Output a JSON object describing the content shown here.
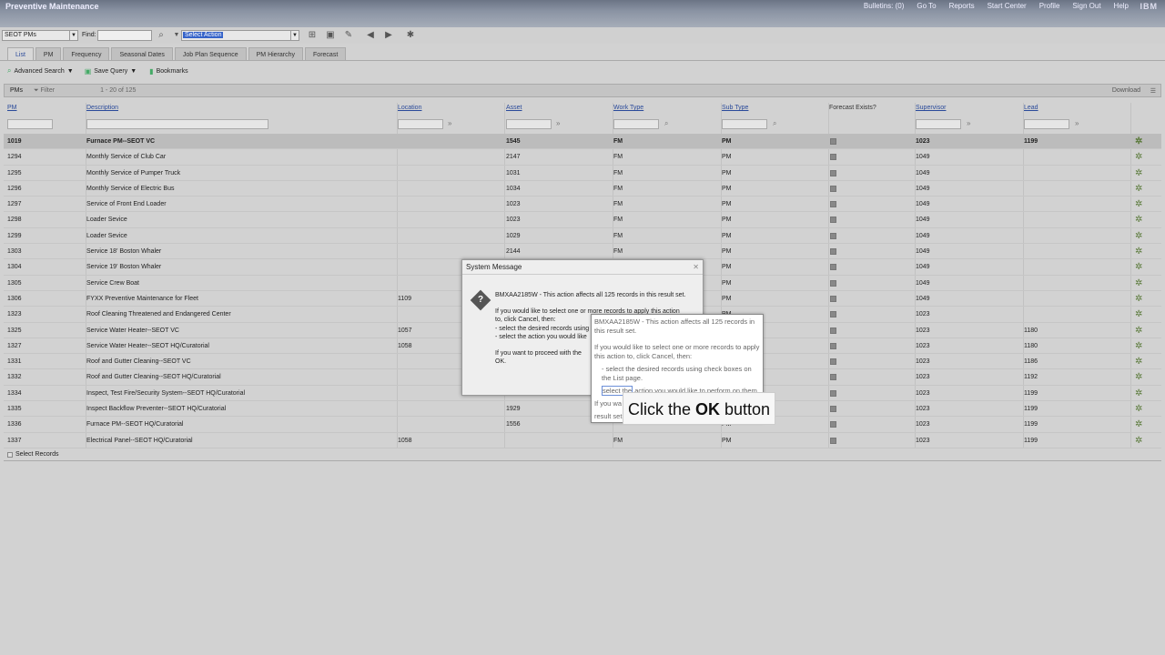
{
  "titlebar": {
    "app_title": "Preventive Maintenance",
    "links": [
      "Bulletins: (0)",
      "Go To",
      "Reports",
      "Start Center",
      "Profile",
      "Sign Out",
      "Help"
    ],
    "brand": "IBM"
  },
  "toolbar": {
    "app_select": "SEOT PMs",
    "find_label": "Find:",
    "find_value": "",
    "action_select": "Select Action"
  },
  "tabs": [
    "List",
    "PM",
    "Frequency",
    "Seasonal Dates",
    "Job Plan Sequence",
    "PM Hierarchy",
    "Forecast"
  ],
  "subbar": {
    "advanced_search": "Advanced Search",
    "save_query": "Save Query",
    "bookmarks": "Bookmarks"
  },
  "table": {
    "title": "PMs",
    "filter_label": "Filter",
    "count": "1 - 20 of 125",
    "download": "Download",
    "columns": [
      "PM",
      "Description",
      "Location",
      "Asset",
      "Work Type",
      "Sub Type",
      "Forecast Exists?",
      "Supervisor",
      "Lead"
    ],
    "rows": [
      {
        "pm": "1019",
        "desc": "Furnace PM--SEOT VC",
        "loc": "",
        "asset": "1545",
        "work": "FM",
        "sub": "PM",
        "sup": "1023",
        "lead": "1199"
      },
      {
        "pm": "1294",
        "desc": "Monthly Service of Club Car",
        "loc": "",
        "asset": "2147",
        "work": "FM",
        "sub": "PM",
        "sup": "1049",
        "lead": ""
      },
      {
        "pm": "1295",
        "desc": "Monthly Service of Pumper Truck",
        "loc": "",
        "asset": "1031",
        "work": "FM",
        "sub": "PM",
        "sup": "1049",
        "lead": ""
      },
      {
        "pm": "1296",
        "desc": "Monthly Service of Electric Bus",
        "loc": "",
        "asset": "1034",
        "work": "FM",
        "sub": "PM",
        "sup": "1049",
        "lead": ""
      },
      {
        "pm": "1297",
        "desc": "Service of Front End Loader",
        "loc": "",
        "asset": "1023",
        "work": "FM",
        "sub": "PM",
        "sup": "1049",
        "lead": ""
      },
      {
        "pm": "1298",
        "desc": "Loader Sevice",
        "loc": "",
        "asset": "1023",
        "work": "FM",
        "sub": "PM",
        "sup": "1049",
        "lead": ""
      },
      {
        "pm": "1299",
        "desc": "Loader Sevice",
        "loc": "",
        "asset": "1029",
        "work": "FM",
        "sub": "PM",
        "sup": "1049",
        "lead": ""
      },
      {
        "pm": "1303",
        "desc": "Service 18' Boston Whaler",
        "loc": "",
        "asset": "2144",
        "work": "FM",
        "sub": "PM",
        "sup": "1049",
        "lead": ""
      },
      {
        "pm": "1304",
        "desc": "Service 19' Boston Whaler",
        "loc": "",
        "asset": "",
        "work": "",
        "sub": "PM",
        "sup": "1049",
        "lead": ""
      },
      {
        "pm": "1305",
        "desc": "Service Crew Boat",
        "loc": "",
        "asset": "",
        "work": "",
        "sub": "PM",
        "sup": "1049",
        "lead": ""
      },
      {
        "pm": "1306",
        "desc": "FYXX Preventive Maintenance for Fleet",
        "loc": "1109",
        "asset": "",
        "work": "",
        "sub": "PM",
        "sup": "1049",
        "lead": ""
      },
      {
        "pm": "1323",
        "desc": "Roof Cleaning Threatened and Endangered Center",
        "loc": "",
        "asset": "",
        "work": "",
        "sub": "PM",
        "sup": "1023",
        "lead": ""
      },
      {
        "pm": "1325",
        "desc": "Service Water Heater--SEOT VC",
        "loc": "1057",
        "asset": "",
        "work": "",
        "sub": "PM",
        "sup": "1023",
        "lead": "1180"
      },
      {
        "pm": "1327",
        "desc": "Service Water Heater--SEOT HQ/Curatorial",
        "loc": "1058",
        "asset": "",
        "work": "",
        "sub": "PM",
        "sup": "1023",
        "lead": "1180"
      },
      {
        "pm": "1331",
        "desc": "Roof and Gutter Cleaning--SEOT VC",
        "loc": "",
        "asset": "",
        "work": "",
        "sub": "PM",
        "sup": "1023",
        "lead": "1186"
      },
      {
        "pm": "1332",
        "desc": "Roof and Gutter Cleaning--SEOT HQ/Curatorial",
        "loc": "",
        "asset": "",
        "work": "",
        "sub": "PM",
        "sup": "1023",
        "lead": "1192"
      },
      {
        "pm": "1334",
        "desc": "Inspect, Test Fire/Security System--SEOT HQ/Curatorial",
        "loc": "",
        "asset": "",
        "work": "",
        "sub": "PM",
        "sup": "1023",
        "lead": "1199"
      },
      {
        "pm": "1335",
        "desc": "Inspect Backflow Preventer--SEOT HQ/Curatorial",
        "loc": "",
        "asset": "1929",
        "work": "",
        "sub": "PM",
        "sup": "1023",
        "lead": "1199"
      },
      {
        "pm": "1336",
        "desc": "Furnace PM--SEOT HQ/Curatorial",
        "loc": "",
        "asset": "1556",
        "work": "",
        "sub": "PM",
        "sup": "1023",
        "lead": "1199"
      },
      {
        "pm": "1337",
        "desc": "Electrical Panel--SEOT HQ/Curatorial",
        "loc": "1058",
        "asset": "",
        "work": "FM",
        "sub": "PM",
        "sup": "1023",
        "lead": "1199"
      }
    ],
    "select_records": "Select Records"
  },
  "dialog": {
    "title": "System Message",
    "p1": "BMXAA2185W - This action affects all 125 records in this result set.",
    "p2a": "If you would like to select one or more records to apply this action",
    "p2b": "to, click Cancel, then:",
    "p2c": "- select the desired records using",
    "p2d": "- select the action you would like",
    "p3a": "If you want to proceed with the",
    "p3b": "OK."
  },
  "zoom": {
    "p1": "BMXAA2185W - This action affects all 125 records in this result set.",
    "p2": "If you would like to select one or more records to apply this action to, click Cancel, then:",
    "p3": "- select the desired records using check boxes on the List page.",
    "p4_hl": "select the",
    "p4_rest": " action you would like to perform on them.",
    "p5": "If you wa",
    "p6": "result set"
  },
  "callout": {
    "pre": "Click the ",
    "bold": "OK",
    "post": " button"
  }
}
